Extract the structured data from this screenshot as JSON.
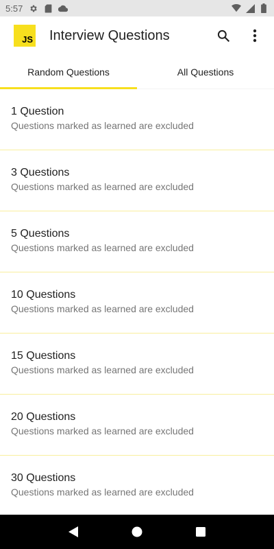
{
  "status_bar": {
    "time": "5:57",
    "left_icons": [
      "gear-icon",
      "sd-card-icon",
      "cloud-icon"
    ],
    "right_icons": [
      "wifi-icon",
      "signal-icon",
      "battery-icon"
    ]
  },
  "app_bar": {
    "logo_text": "JS",
    "title": "Interview Questions",
    "actions": [
      "search-icon",
      "more-vert-icon"
    ]
  },
  "tabs": [
    {
      "label": "Random Questions",
      "active": true
    },
    {
      "label": "All Questions",
      "active": false
    }
  ],
  "list": {
    "items": [
      {
        "title": "1 Question",
        "subtitle": "Questions marked as learned are excluded"
      },
      {
        "title": "3 Questions",
        "subtitle": "Questions marked as learned are excluded"
      },
      {
        "title": "5 Questions",
        "subtitle": "Questions marked as learned are excluded"
      },
      {
        "title": "10 Questions",
        "subtitle": "Questions marked as learned are excluded"
      },
      {
        "title": "15 Questions",
        "subtitle": "Questions marked as learned are excluded"
      },
      {
        "title": "20 Questions",
        "subtitle": "Questions marked as learned are excluded"
      },
      {
        "title": "30 Questions",
        "subtitle": "Questions marked as learned are excluded"
      }
    ]
  },
  "colors": {
    "accent": "#f7df1e",
    "status_bar_bg": "#e6e6e6",
    "nav_bar_bg": "#000000",
    "divider": "#f9ef9c"
  },
  "nav_bar": {
    "buttons": [
      "back-icon",
      "home-icon",
      "recents-icon"
    ]
  }
}
